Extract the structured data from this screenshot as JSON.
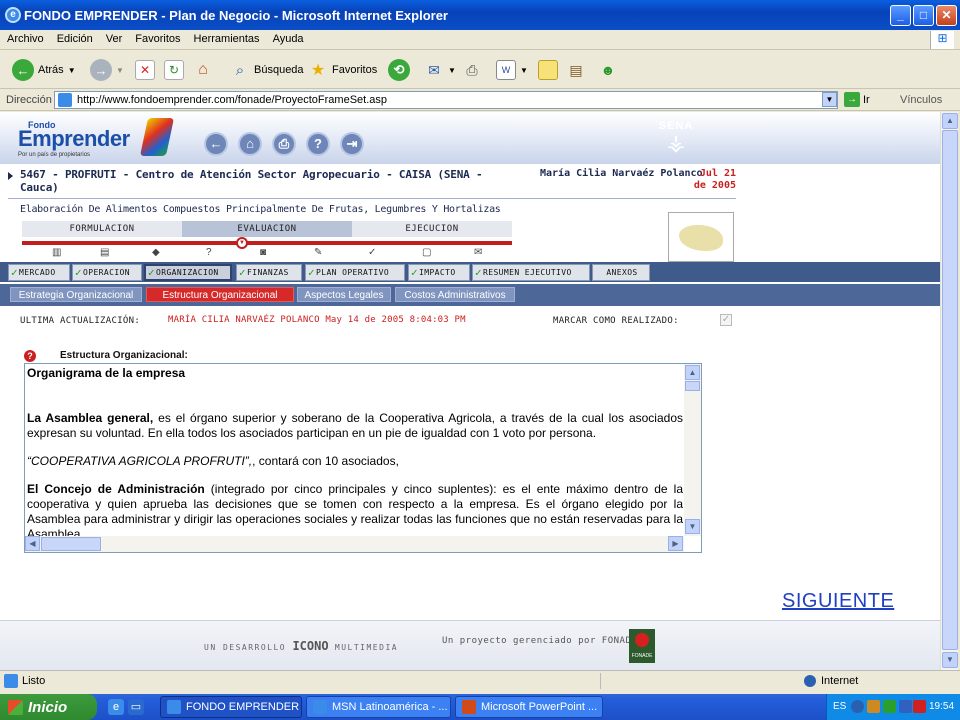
{
  "window": {
    "title": "FONDO EMPRENDER - Plan de Negocio - Microsoft Internet Explorer"
  },
  "menubar": {
    "items": [
      "Archivo",
      "Edición",
      "Ver",
      "Favoritos",
      "Herramientas",
      "Ayuda"
    ]
  },
  "toolbar": {
    "back_label": "Atrás",
    "search_label": "Búsqueda",
    "favorites_label": "Favoritos"
  },
  "address": {
    "label": "Dirección",
    "url": "http://www.fondoemprender.com/fonade/ProyectoFrameSet.asp",
    "go_label": "Ir",
    "links_label": "Vínculos"
  },
  "site": {
    "logo_small": "Fondo",
    "logo_big": "Emprender",
    "logo_tagline": "Por un país de propietarios",
    "sena": "SENA",
    "project_title": "5467 - PROFRUTI - Centro de Atención Sector Agropecuario - CAISA (SENA - Cauca)",
    "user_name": "María Cilia Narvaéz Polanco",
    "user_date": "Jul 21 de 2005",
    "subtitle": "Elaboración De Alimentos Compuestos Principalmente De Frutas, Legumbres Y Hortalizas",
    "phases": [
      "FORMULACION",
      "EVALUACION",
      "EJECUCION"
    ]
  },
  "tabs_main": [
    "MERCADO",
    "OPERACION",
    "ORGANIZACION",
    "FINANZAS",
    "PLAN OPERATIVO",
    "IMPACTO",
    "RESUMEN EJECUTIVO",
    "ANEXOS"
  ],
  "tabs_sub": [
    "Estrategia Organizacional",
    "Estructura Organizacional",
    "Aspectos Legales",
    "Costos Administrativos"
  ],
  "update": {
    "label": "ULTIMA ACTUALIZACIÓN:",
    "value": "MARÍA CILIA NARVAÉZ POLANCO  May 14 de 2005 8:04:03 PM",
    "mark_label": "MARCAR COMO REALIZADO:",
    "mark_checked": true
  },
  "editor": {
    "label": "Estructura Organizacional:",
    "heading": "Organigrama de la empresa",
    "p1_bold": "La Asamblea general,",
    "p1_rest": " es el órgano superior y soberano de la Cooperativa Agricola, a través de la cual los asociados expresan su voluntad. En ella todos los asociados participan en un pie de igualdad con 1 voto por persona.",
    "p2_italic": "“COOPERATIVA AGRICOLA PROFRUTI”,",
    "p2_rest": ", contará con 10 asociados,",
    "p3_bold": "El Concejo de Administración",
    "p3_rest": " (integrado por cinco principales y cinco suplentes): es el ente máximo dentro de la cooperativa y quien aprueba las decisiones que se tomen con respecto a la empresa. Es el órgano elegido por la Asamblea para administrar y dirigir las operaciones sociales y realizar todas las funciones que no están reservadas para la Asamblea"
  },
  "next_link": "SIGUIENTE",
  "footer": {
    "dev_prefix": "UN DESARROLLO",
    "dev_brand": "ICONO",
    "dev_suffix": "MULTIMEDIA",
    "managed": "Un proyecto gerenciado por  FONADE",
    "fonade": "FONADE"
  },
  "status": {
    "text": "Listo",
    "zone": "Internet"
  },
  "taskbar": {
    "start": "Inicio",
    "tasks": [
      "FONDO EMPRENDER ...",
      "MSN Latinoamérica - ...",
      "Microsoft PowerPoint ..."
    ],
    "lang": "ES",
    "clock": "19:54"
  }
}
